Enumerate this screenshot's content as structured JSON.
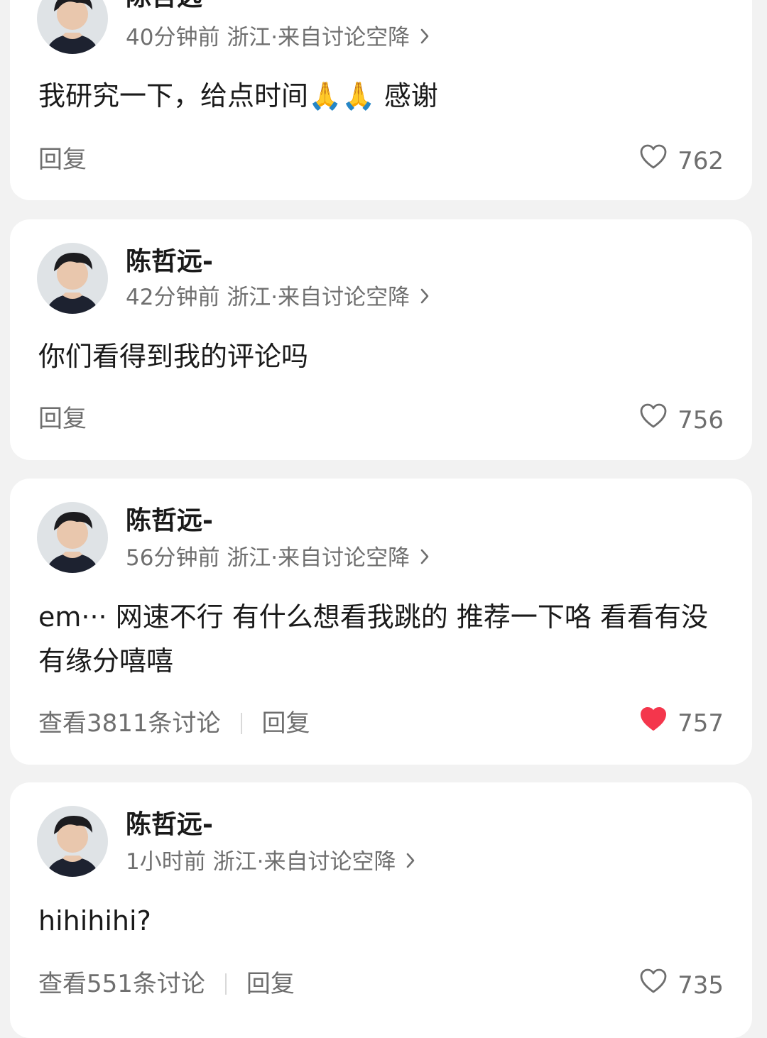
{
  "comments": [
    {
      "name": "陈哲远-",
      "time": "40分钟前",
      "location": "浙江·来自讨论空降",
      "text": "我研究一下，给点时间🙏🙏 感谢",
      "reply": "回复",
      "likes": "762",
      "liked": false
    },
    {
      "name": "陈哲远-",
      "time": "42分钟前",
      "location": "浙江·来自讨论空降",
      "text": "你们看得到我的评论吗",
      "reply": "回复",
      "likes": "756",
      "liked": false
    },
    {
      "name": "陈哲远-",
      "time": "56分钟前",
      "location": "浙江·来自讨论空降",
      "text": "em··· 网速不行 有什么想看我跳的 推荐一下咯 看看有没有缘分嘻嘻",
      "view_discussion": "查看3811条讨论",
      "reply": "回复",
      "likes": "757",
      "liked": true
    },
    {
      "name": "陈哲远-",
      "time": "1小时前",
      "location": "浙江·来自讨论空降",
      "text": "hihihihi?",
      "view_discussion": "查看551条讨论",
      "reply": "回复",
      "likes": "735",
      "liked": false
    }
  ],
  "colors": {
    "like_active": "#f4364c",
    "meta": "#6f6f6f",
    "text": "#1a1a1a"
  }
}
